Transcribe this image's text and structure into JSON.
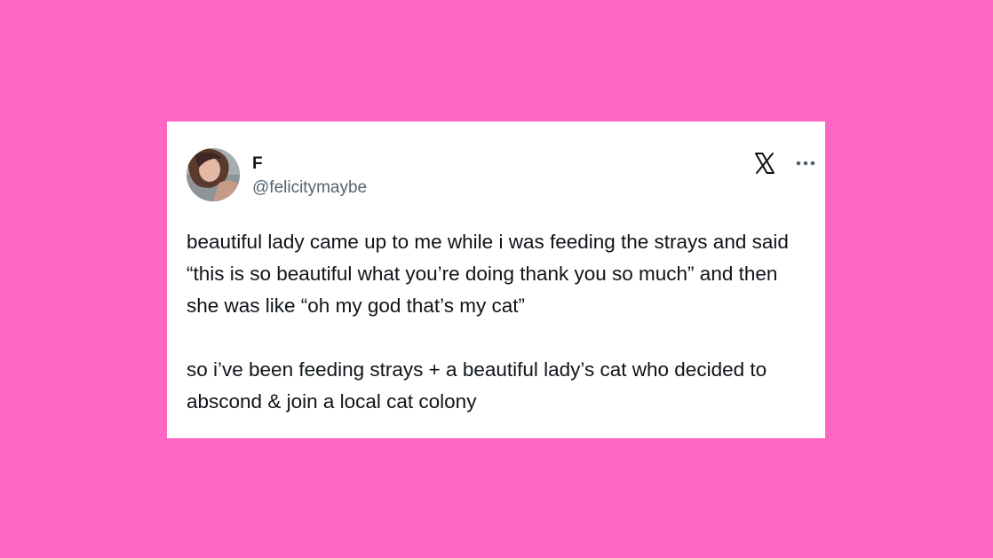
{
  "background_color": "#ff66c4",
  "tweet": {
    "author": {
      "display_name": "F",
      "handle": "@felicitymaybe",
      "avatar_icon": "profile-photo"
    },
    "header_icons": [
      "x-logo-icon",
      "more-options-icon"
    ],
    "paragraphs": [
      "beautiful lady came up to me while i was feeding the strays and said “this is so beautiful what you’re doing thank you so much” and then she was like “oh my god that’s my cat”",
      "so i’ve been feeding strays + a beautiful lady’s cat who decided to abscond & join a local cat colony"
    ]
  }
}
